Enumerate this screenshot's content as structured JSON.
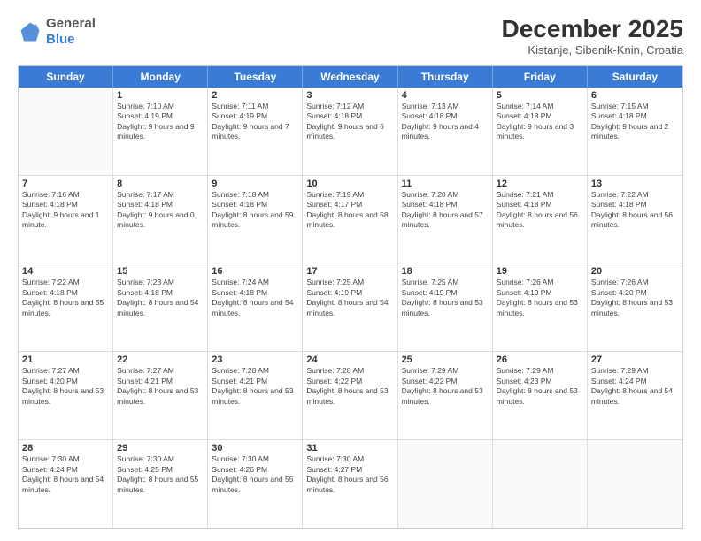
{
  "header": {
    "logo_general": "General",
    "logo_blue": "Blue",
    "month_title": "December 2025",
    "subtitle": "Kistanje, Sibenik-Knin, Croatia"
  },
  "days": [
    "Sunday",
    "Monday",
    "Tuesday",
    "Wednesday",
    "Thursday",
    "Friday",
    "Saturday"
  ],
  "rows": [
    [
      {
        "day": "",
        "sunrise": "",
        "sunset": "",
        "daylight": ""
      },
      {
        "day": "1",
        "sunrise": "Sunrise: 7:10 AM",
        "sunset": "Sunset: 4:19 PM",
        "daylight": "Daylight: 9 hours and 9 minutes."
      },
      {
        "day": "2",
        "sunrise": "Sunrise: 7:11 AM",
        "sunset": "Sunset: 4:19 PM",
        "daylight": "Daylight: 9 hours and 7 minutes."
      },
      {
        "day": "3",
        "sunrise": "Sunrise: 7:12 AM",
        "sunset": "Sunset: 4:18 PM",
        "daylight": "Daylight: 9 hours and 6 minutes."
      },
      {
        "day": "4",
        "sunrise": "Sunrise: 7:13 AM",
        "sunset": "Sunset: 4:18 PM",
        "daylight": "Daylight: 9 hours and 4 minutes."
      },
      {
        "day": "5",
        "sunrise": "Sunrise: 7:14 AM",
        "sunset": "Sunset: 4:18 PM",
        "daylight": "Daylight: 9 hours and 3 minutes."
      },
      {
        "day": "6",
        "sunrise": "Sunrise: 7:15 AM",
        "sunset": "Sunset: 4:18 PM",
        "daylight": "Daylight: 9 hours and 2 minutes."
      }
    ],
    [
      {
        "day": "7",
        "sunrise": "Sunrise: 7:16 AM",
        "sunset": "Sunset: 4:18 PM",
        "daylight": "Daylight: 9 hours and 1 minute."
      },
      {
        "day": "8",
        "sunrise": "Sunrise: 7:17 AM",
        "sunset": "Sunset: 4:18 PM",
        "daylight": "Daylight: 9 hours and 0 minutes."
      },
      {
        "day": "9",
        "sunrise": "Sunrise: 7:18 AM",
        "sunset": "Sunset: 4:18 PM",
        "daylight": "Daylight: 8 hours and 59 minutes."
      },
      {
        "day": "10",
        "sunrise": "Sunrise: 7:19 AM",
        "sunset": "Sunset: 4:17 PM",
        "daylight": "Daylight: 8 hours and 58 minutes."
      },
      {
        "day": "11",
        "sunrise": "Sunrise: 7:20 AM",
        "sunset": "Sunset: 4:18 PM",
        "daylight": "Daylight: 8 hours and 57 minutes."
      },
      {
        "day": "12",
        "sunrise": "Sunrise: 7:21 AM",
        "sunset": "Sunset: 4:18 PM",
        "daylight": "Daylight: 8 hours and 56 minutes."
      },
      {
        "day": "13",
        "sunrise": "Sunrise: 7:22 AM",
        "sunset": "Sunset: 4:18 PM",
        "daylight": "Daylight: 8 hours and 56 minutes."
      }
    ],
    [
      {
        "day": "14",
        "sunrise": "Sunrise: 7:22 AM",
        "sunset": "Sunset: 4:18 PM",
        "daylight": "Daylight: 8 hours and 55 minutes."
      },
      {
        "day": "15",
        "sunrise": "Sunrise: 7:23 AM",
        "sunset": "Sunset: 4:18 PM",
        "daylight": "Daylight: 8 hours and 54 minutes."
      },
      {
        "day": "16",
        "sunrise": "Sunrise: 7:24 AM",
        "sunset": "Sunset: 4:18 PM",
        "daylight": "Daylight: 8 hours and 54 minutes."
      },
      {
        "day": "17",
        "sunrise": "Sunrise: 7:25 AM",
        "sunset": "Sunset: 4:19 PM",
        "daylight": "Daylight: 8 hours and 54 minutes."
      },
      {
        "day": "18",
        "sunrise": "Sunrise: 7:25 AM",
        "sunset": "Sunset: 4:19 PM",
        "daylight": "Daylight: 8 hours and 53 minutes."
      },
      {
        "day": "19",
        "sunrise": "Sunrise: 7:26 AM",
        "sunset": "Sunset: 4:19 PM",
        "daylight": "Daylight: 8 hours and 53 minutes."
      },
      {
        "day": "20",
        "sunrise": "Sunrise: 7:26 AM",
        "sunset": "Sunset: 4:20 PM",
        "daylight": "Daylight: 8 hours and 53 minutes."
      }
    ],
    [
      {
        "day": "21",
        "sunrise": "Sunrise: 7:27 AM",
        "sunset": "Sunset: 4:20 PM",
        "daylight": "Daylight: 8 hours and 53 minutes."
      },
      {
        "day": "22",
        "sunrise": "Sunrise: 7:27 AM",
        "sunset": "Sunset: 4:21 PM",
        "daylight": "Daylight: 8 hours and 53 minutes."
      },
      {
        "day": "23",
        "sunrise": "Sunrise: 7:28 AM",
        "sunset": "Sunset: 4:21 PM",
        "daylight": "Daylight: 8 hours and 53 minutes."
      },
      {
        "day": "24",
        "sunrise": "Sunrise: 7:28 AM",
        "sunset": "Sunset: 4:22 PM",
        "daylight": "Daylight: 8 hours and 53 minutes."
      },
      {
        "day": "25",
        "sunrise": "Sunrise: 7:29 AM",
        "sunset": "Sunset: 4:22 PM",
        "daylight": "Daylight: 8 hours and 53 minutes."
      },
      {
        "day": "26",
        "sunrise": "Sunrise: 7:29 AM",
        "sunset": "Sunset: 4:23 PM",
        "daylight": "Daylight: 8 hours and 53 minutes."
      },
      {
        "day": "27",
        "sunrise": "Sunrise: 7:29 AM",
        "sunset": "Sunset: 4:24 PM",
        "daylight": "Daylight: 8 hours and 54 minutes."
      }
    ],
    [
      {
        "day": "28",
        "sunrise": "Sunrise: 7:30 AM",
        "sunset": "Sunset: 4:24 PM",
        "daylight": "Daylight: 8 hours and 54 minutes."
      },
      {
        "day": "29",
        "sunrise": "Sunrise: 7:30 AM",
        "sunset": "Sunset: 4:25 PM",
        "daylight": "Daylight: 8 hours and 55 minutes."
      },
      {
        "day": "30",
        "sunrise": "Sunrise: 7:30 AM",
        "sunset": "Sunset: 4:26 PM",
        "daylight": "Daylight: 8 hours and 55 minutes."
      },
      {
        "day": "31",
        "sunrise": "Sunrise: 7:30 AM",
        "sunset": "Sunset: 4:27 PM",
        "daylight": "Daylight: 8 hours and 56 minutes."
      },
      {
        "day": "",
        "sunrise": "",
        "sunset": "",
        "daylight": ""
      },
      {
        "day": "",
        "sunrise": "",
        "sunset": "",
        "daylight": ""
      },
      {
        "day": "",
        "sunrise": "",
        "sunset": "",
        "daylight": ""
      }
    ]
  ]
}
